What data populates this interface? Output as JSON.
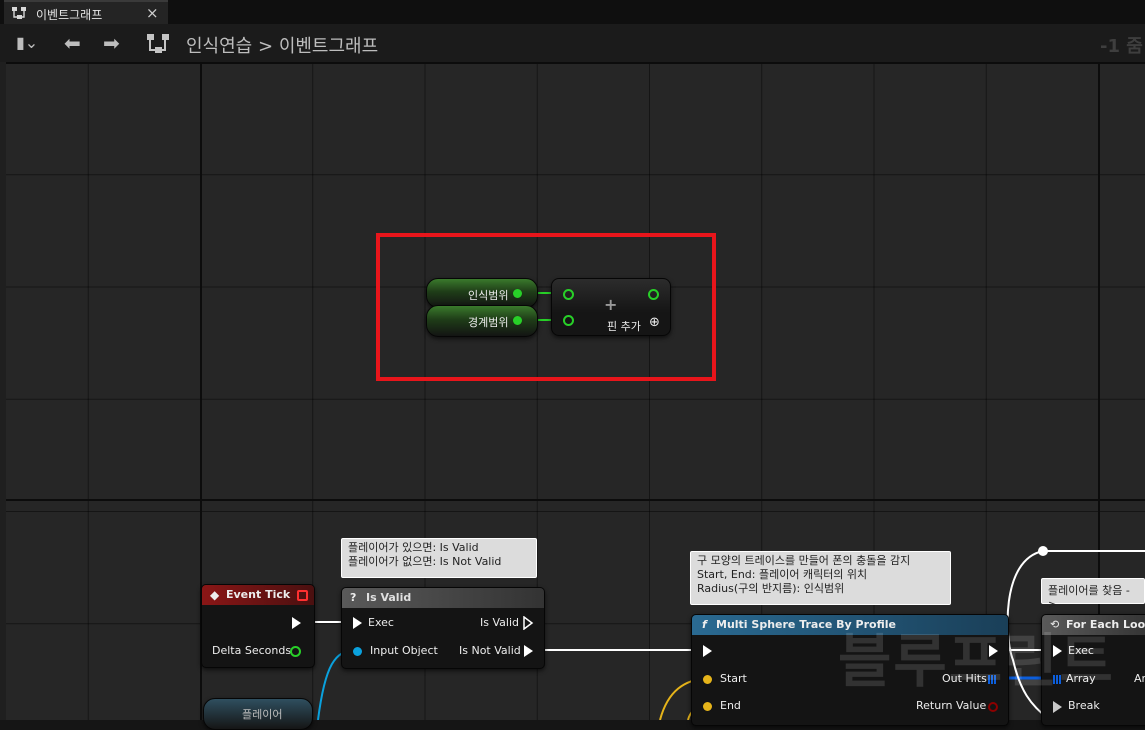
{
  "tab": {
    "title": "이벤트그래프",
    "close": "×"
  },
  "toolbar": {
    "bookmark": "▮⌄",
    "back": "⬅",
    "forward": "➡",
    "breadcrumb_root": "인식연습",
    "breadcrumb_sep": ">",
    "breadcrumb_current": "이벤트그래프",
    "zoom": "-1 줌"
  },
  "highlight_group": {
    "var1": "인식범위",
    "var2": "경계범위",
    "plus": "+",
    "add_pin": "핀 추가",
    "add_pin_icon": "⊕"
  },
  "comments": {
    "isvalid_line1": "플레이어가 있으면: Is Valid",
    "isvalid_line2": "플레이어가 없으면: Is Not Valid",
    "trace_line1": "구 모양의 트레이스를 만들어 폰의 충돌을 감지",
    "trace_line2": "Start, End: 플레이어 캐릭터의 위치",
    "trace_line3": "Radius(구의 반지름): 인식범위",
    "foreach": "플레이어를 찾음 ->"
  },
  "nodes": {
    "event_tick": {
      "title": "Event Tick",
      "pin_delta": "Delta Seconds"
    },
    "is_valid": {
      "icon": "?",
      "title": "Is Valid",
      "pin_exec": "Exec",
      "pin_input": "Input Object",
      "out_valid": "Is Valid",
      "out_not_valid": "Is Not Valid"
    },
    "multi_sphere": {
      "icon": "f",
      "title": "Multi Sphere Trace By Profile",
      "pin_start": "Start",
      "pin_end": "End",
      "out_hits": "Out Hits",
      "out_return": "Return Value"
    },
    "for_each": {
      "title": "For Each Loop",
      "pin_exec": "Exec",
      "pin_array": "Array",
      "pin_break": "Break",
      "out_ar": "Ar"
    },
    "bottom_var": "플레이어"
  },
  "watermark": "블루프린트",
  "colors": {
    "exec": "#ffffff",
    "float_pin": "#28d028",
    "object_pin": "#0aa1dd",
    "vector_pin": "#e6b41a",
    "struct_pin": "#0c5edc",
    "bool_pin": "#8c0000",
    "highlight": "#e8151b",
    "event_header": "#8a1616",
    "func_header": "#2a6a92"
  }
}
